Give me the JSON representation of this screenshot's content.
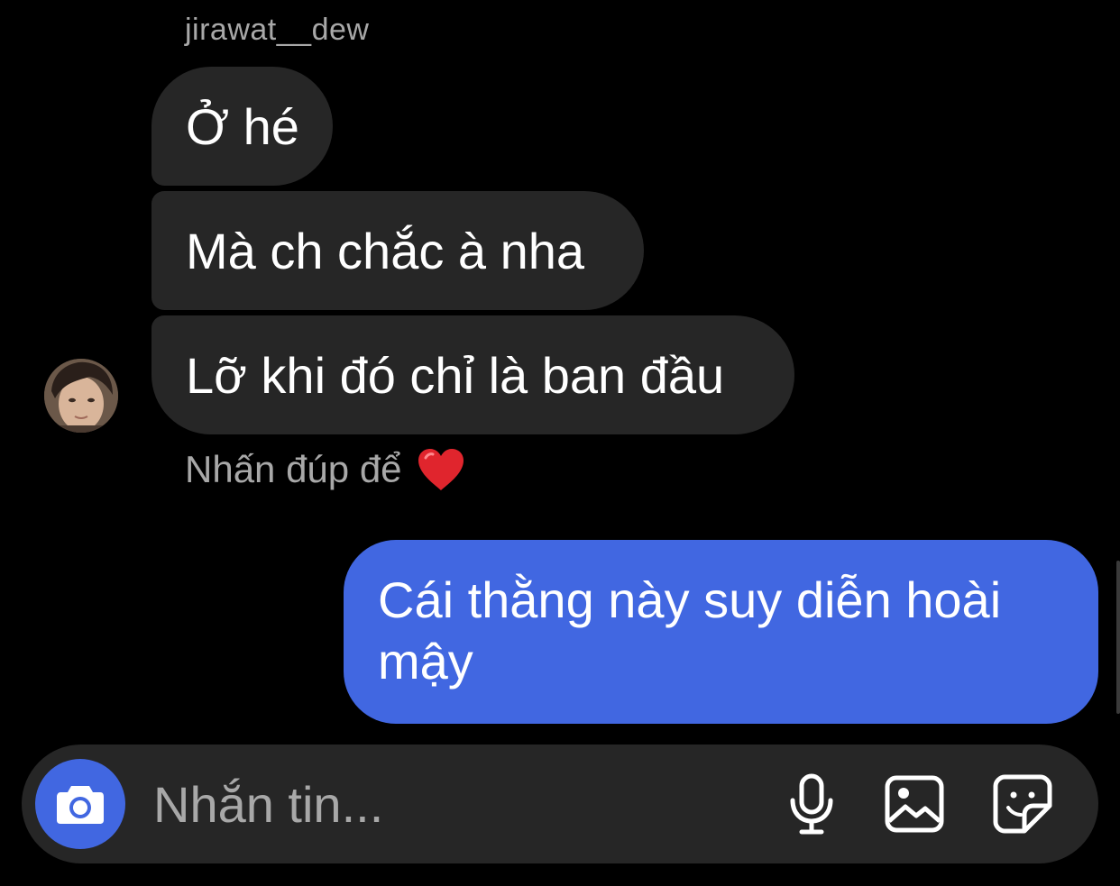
{
  "conversation": {
    "sender_username": "jirawat__dew",
    "incoming_messages": [
      {
        "text": "Ở hé"
      },
      {
        "text": "Mà ch chắc à nha"
      },
      {
        "text": "Lỡ khi đó chỉ là ban đầu"
      }
    ],
    "reaction_hint": {
      "text": "Nhấn đúp để",
      "icon": "heart-icon",
      "icon_color": "#e0252d"
    },
    "outgoing_messages": [
      {
        "text": "Cái thằng này suy diễn hoài mậy"
      }
    ]
  },
  "composer": {
    "placeholder": "Nhắn tin...",
    "value": "",
    "buttons": [
      "camera-icon",
      "microphone-icon",
      "gallery-icon",
      "sticker-icon"
    ]
  },
  "colors": {
    "background": "#000000",
    "incoming_bubble": "#262626",
    "outgoing_bubble": "#4167e1",
    "secondary_text": "#a8a8a8",
    "composer_background": "#262626"
  }
}
